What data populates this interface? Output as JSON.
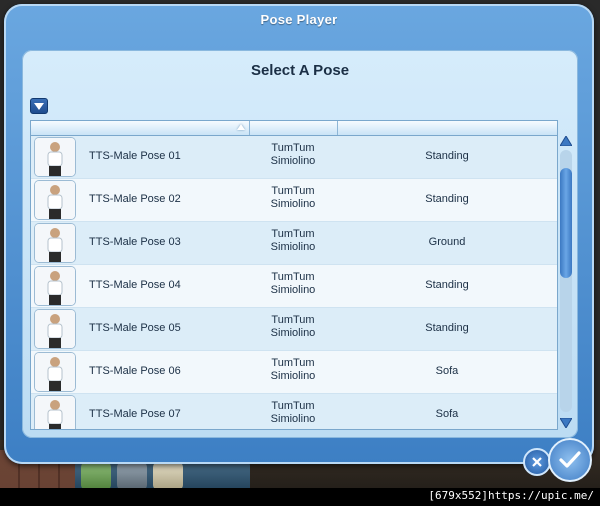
{
  "dialog": {
    "title": "Pose Player"
  },
  "panel": {
    "title": "Select A Pose"
  },
  "rows": [
    {
      "name": "TTS-Male Pose 01",
      "author_1": "TumTum",
      "author_2": "Simiolino",
      "type": "Standing"
    },
    {
      "name": "TTS-Male Pose 02",
      "author_1": "TumTum",
      "author_2": "Simiolino",
      "type": "Standing"
    },
    {
      "name": "TTS-Male Pose 03",
      "author_1": "TumTum",
      "author_2": "Simiolino",
      "type": "Ground"
    },
    {
      "name": "TTS-Male Pose 04",
      "author_1": "TumTum",
      "author_2": "Simiolino",
      "type": "Standing"
    },
    {
      "name": "TTS-Male Pose 05",
      "author_1": "TumTum",
      "author_2": "Simiolino",
      "type": "Standing"
    },
    {
      "name": "TTS-Male Pose 06",
      "author_1": "TumTum",
      "author_2": "Simiolino",
      "type": "Sofa"
    },
    {
      "name": "TTS-Male Pose 07",
      "author_1": "TumTum",
      "author_2": "Simiolino",
      "type": "Sofa"
    }
  ],
  "icons": {
    "filter": "dropdown-arrow-icon",
    "sort": "sort-ascending-icon",
    "cancel": "close-icon",
    "confirm": "checkmark-icon"
  },
  "watermark": "[679x552]https://upic.me/",
  "colors": {
    "dialog": "#3d7fc4",
    "panel": "#bcdcf3",
    "accent": "#3b78c2"
  }
}
